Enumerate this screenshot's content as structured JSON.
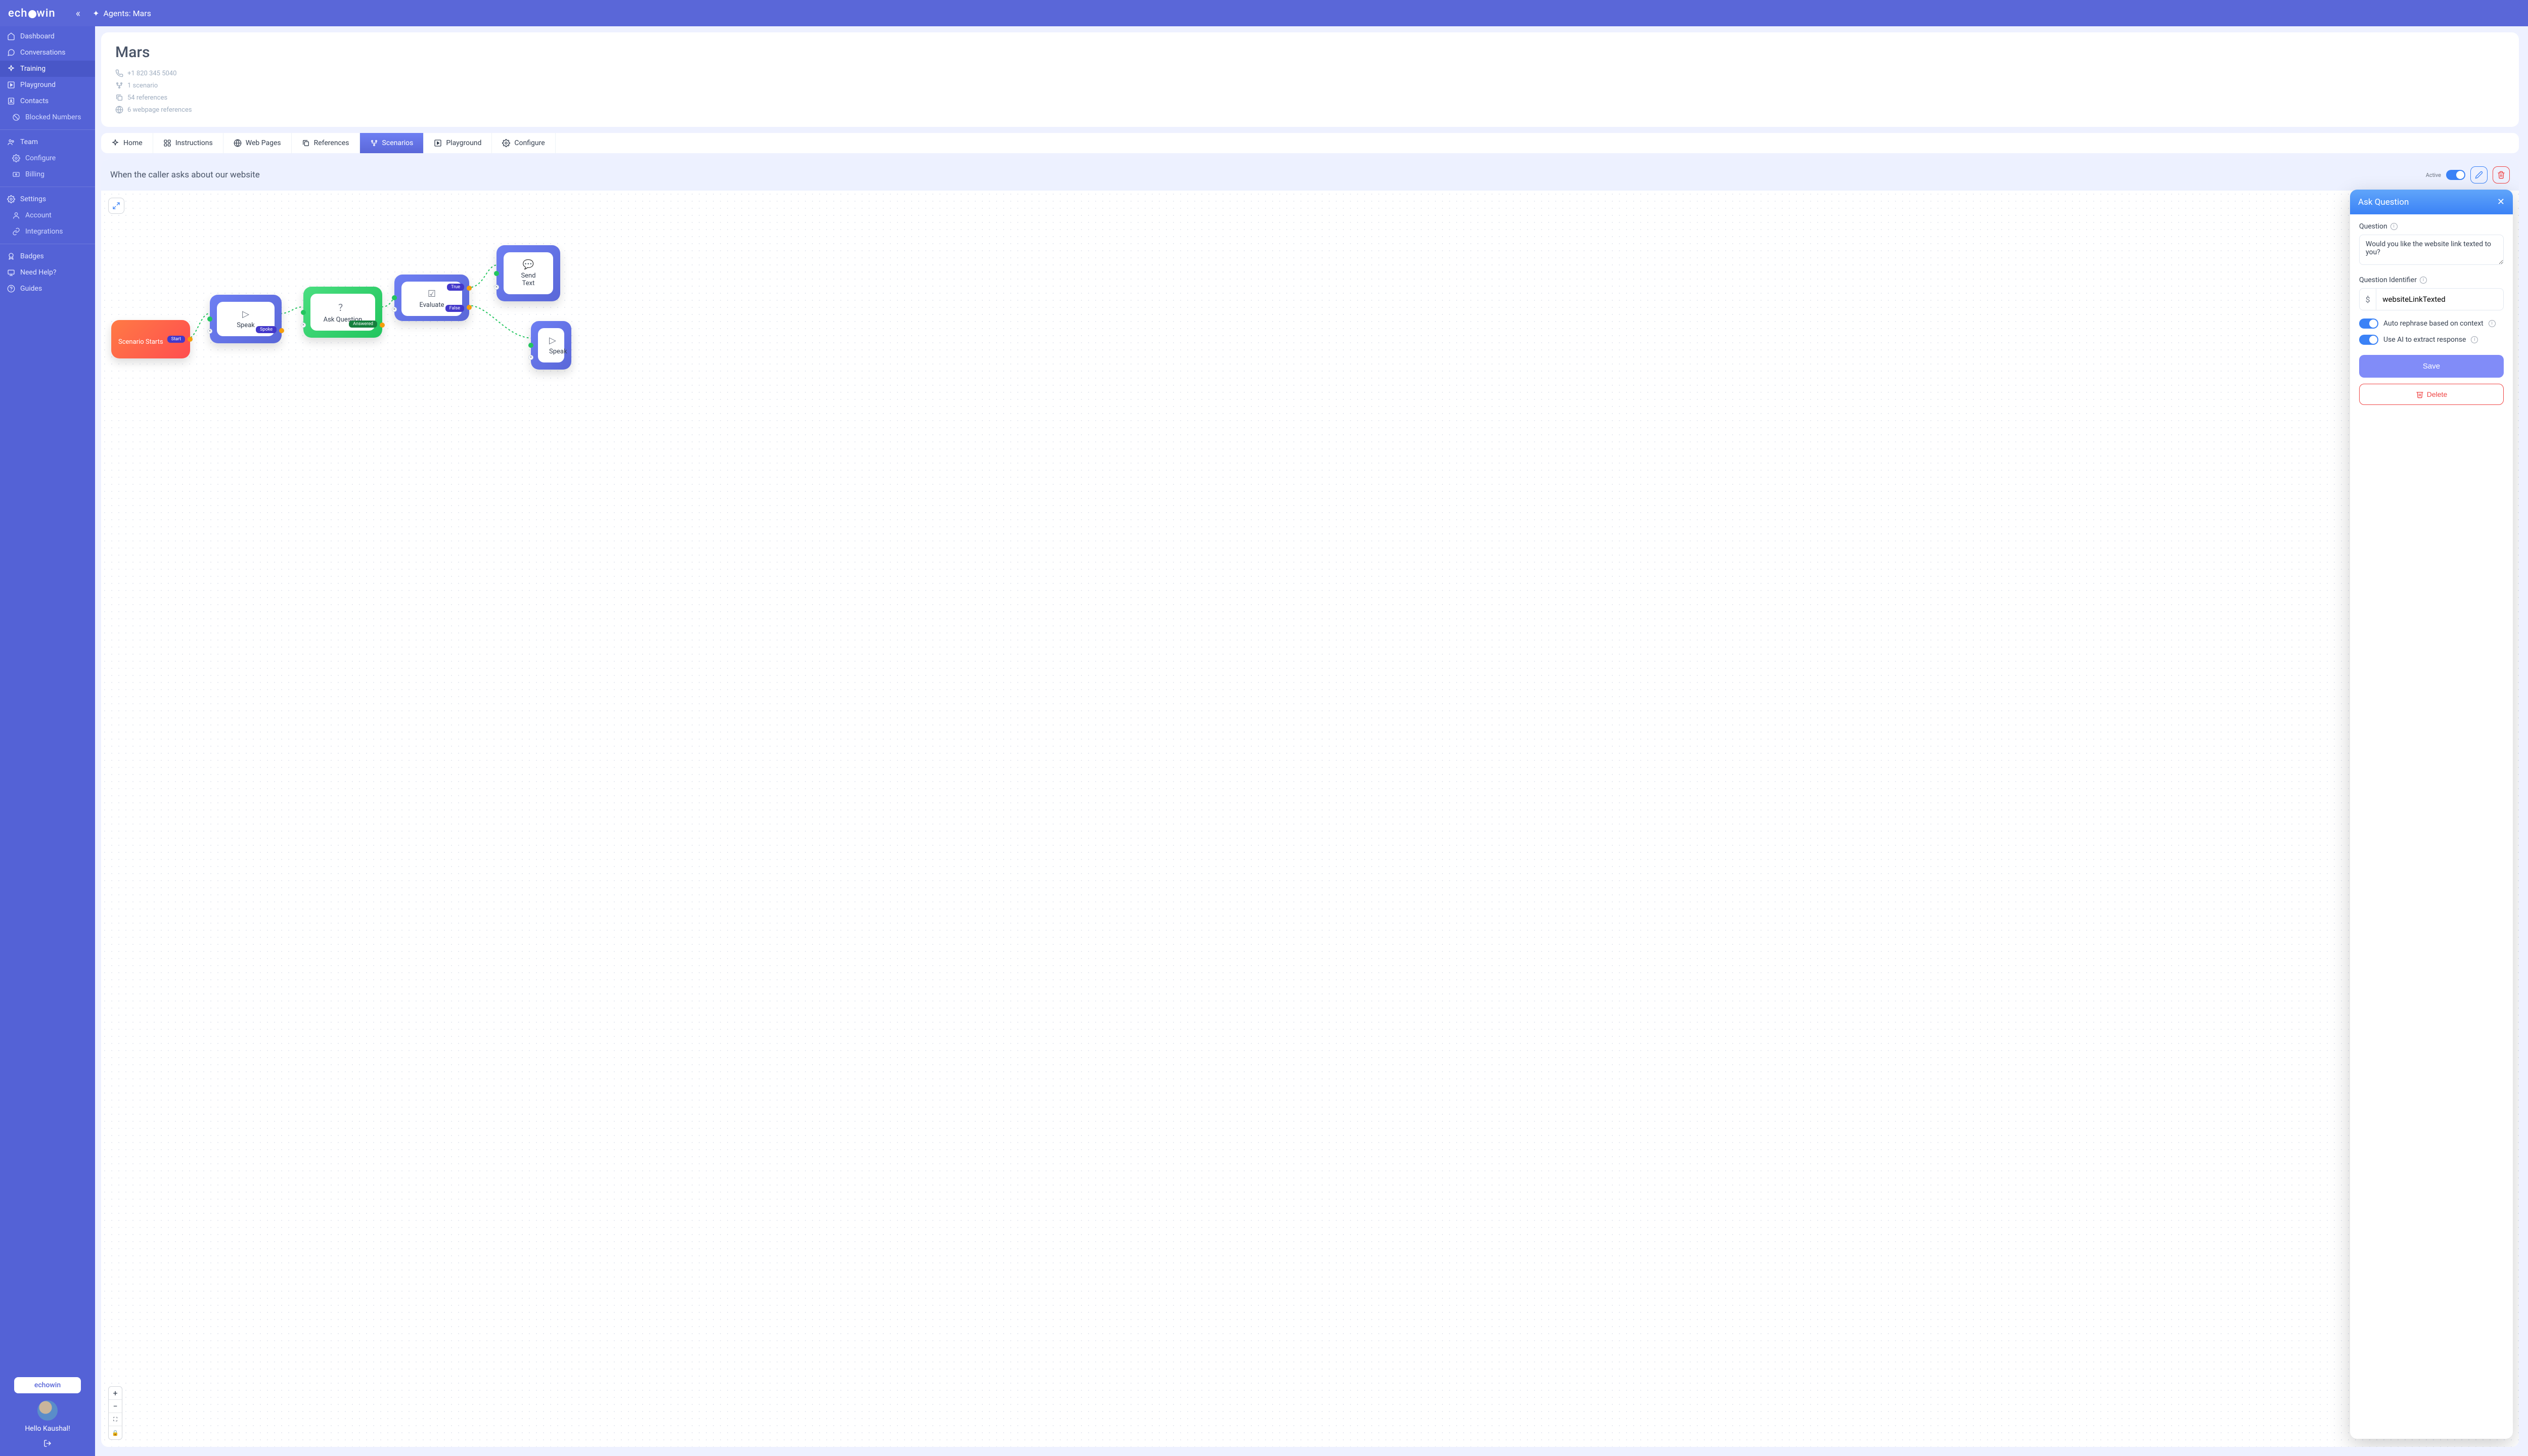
{
  "logo": "echowin",
  "breadcrumb": "Agents: Mars",
  "sidebar": {
    "items": [
      {
        "icon": "home",
        "label": "Dashboard"
      },
      {
        "icon": "chat",
        "label": "Conversations"
      },
      {
        "icon": "spark",
        "label": "Training",
        "active": true
      },
      {
        "icon": "play",
        "label": "Playground"
      },
      {
        "icon": "contact",
        "label": "Contacts"
      },
      {
        "icon": "block",
        "label": "Blocked Numbers",
        "sub": true
      }
    ],
    "team": [
      {
        "icon": "team",
        "label": "Team"
      },
      {
        "icon": "gear",
        "label": "Configure",
        "sub": true
      },
      {
        "icon": "bill",
        "label": "Billing",
        "sub": true
      }
    ],
    "settings": [
      {
        "icon": "gear",
        "label": "Settings"
      },
      {
        "icon": "user",
        "label": "Account",
        "sub": true
      },
      {
        "icon": "link",
        "label": "Integrations",
        "sub": true
      }
    ],
    "other": [
      {
        "icon": "badge",
        "label": "Badges"
      },
      {
        "icon": "help",
        "label": "Need Help?"
      },
      {
        "icon": "guide",
        "label": "Guides"
      }
    ],
    "tenant": "echowin",
    "greeting": "Hello Kaushal!"
  },
  "header": {
    "title": "Mars",
    "phone": "+1 820 345 5040",
    "scenarios": "1 scenario",
    "references": "54 references",
    "webpages": "6 webpage references"
  },
  "tabs": [
    {
      "icon": "spark",
      "label": "Home"
    },
    {
      "icon": "cmd",
      "label": "Instructions"
    },
    {
      "icon": "globe",
      "label": "Web Pages"
    },
    {
      "icon": "copy",
      "label": "References"
    },
    {
      "icon": "flow",
      "label": "Scenarios",
      "active": true
    },
    {
      "icon": "play",
      "label": "Playground"
    },
    {
      "icon": "gear",
      "label": "Configure"
    }
  ],
  "scenario": {
    "title": "When the caller asks about our website",
    "activeLabel": "Active"
  },
  "nodes": {
    "start": {
      "label": "Scenario Starts",
      "badge": "Start"
    },
    "speak": {
      "label": "Speak",
      "badge": "Spoke"
    },
    "ask": {
      "label": "Ask Question",
      "badge": "Answered"
    },
    "eval": {
      "label": "Evaluate",
      "t": "True",
      "f": "False"
    },
    "sendtext": {
      "label": "Send Text"
    },
    "speak2": {
      "label": "Speak"
    }
  },
  "panel": {
    "title": "Ask Question",
    "questionLabel": "Question",
    "questionValue": "Would you like the website link texted to you?",
    "idLabel": "Question Identifier",
    "idPrefix": "$",
    "idValue": "websiteLinkTexted",
    "opt1": "Auto rephrase based on context",
    "opt2": "Use AI to extract response",
    "save": "Save",
    "delete": "Delete"
  },
  "zoom": {
    "plus": "+",
    "minus": "−",
    "fit": "⛶",
    "lock": "🔒"
  }
}
